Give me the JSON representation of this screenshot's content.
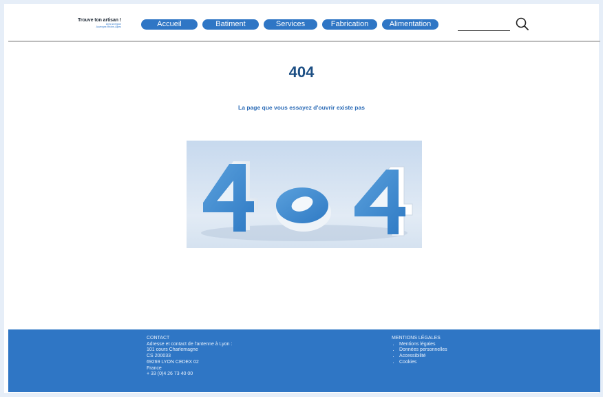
{
  "header": {
    "logo": {
      "title": "Trouve ton artisan !",
      "tagline_line1": "Avec la région",
      "tagline_line2": "Auvergne-Rhône-Alpes"
    },
    "nav": [
      {
        "label": "Accueil"
      },
      {
        "label": "Batiment"
      },
      {
        "label": "Services"
      },
      {
        "label": "Fabrication"
      },
      {
        "label": "Alimentation"
      }
    ],
    "search": {
      "value": "",
      "icon": "search-icon"
    }
  },
  "main": {
    "error_code": "404",
    "message": "La page que vous essayez d'ouvrir existe pas",
    "illustration_text": "404"
  },
  "footer": {
    "contact": {
      "title": "CONTACT",
      "lines": [
        "Adresse et contact de l'antenne à Lyon :",
        "101 cours Charlemagne",
        "CS 200033",
        "69269 LYON CEDEX 02",
        "France",
        "+ 33 (0)4 26 73 40 00"
      ]
    },
    "legal": {
      "title": "MENTIONS LÉGALES",
      "links": [
        "Mentions légales",
        "Données personnelles",
        "Accessibilité",
        "Cookies"
      ]
    }
  },
  "colors": {
    "brand_blue": "#2f76c5",
    "heading_blue": "#1d4f84",
    "text_blue": "#2e6db7"
  }
}
